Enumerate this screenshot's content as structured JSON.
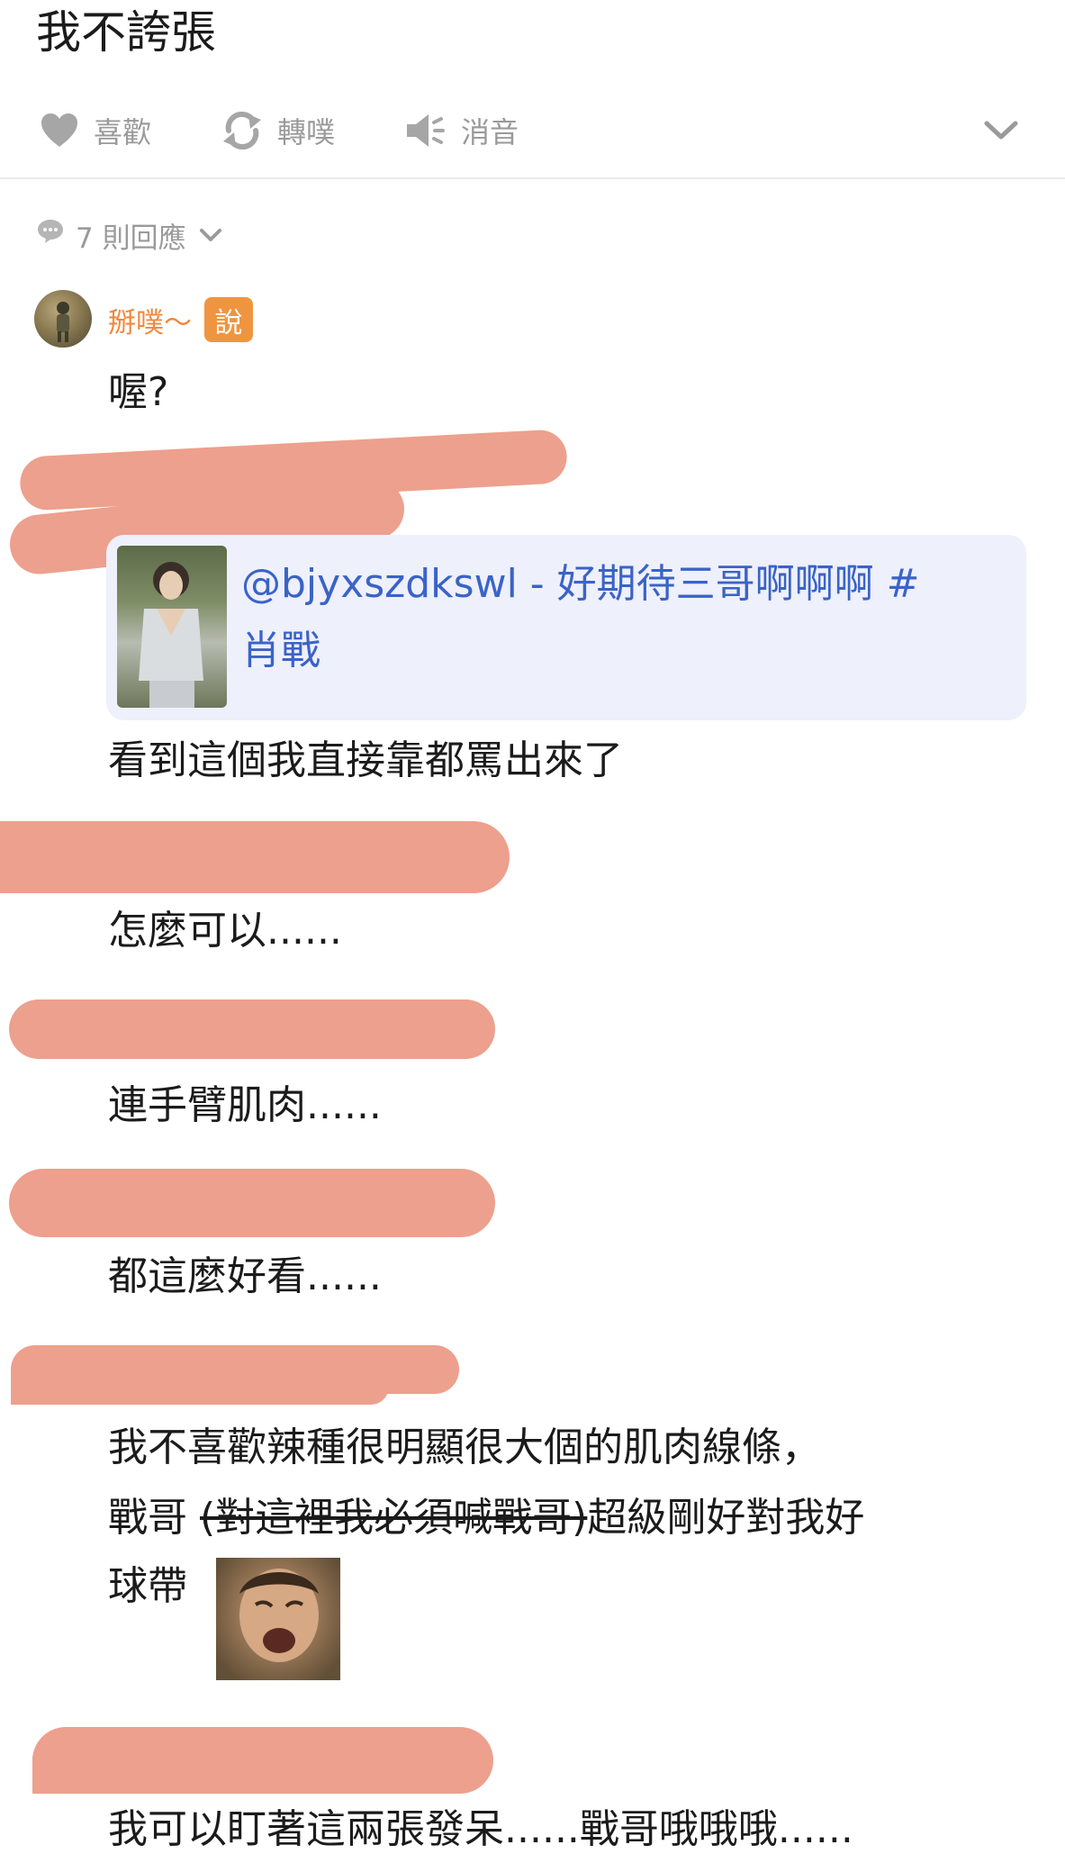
{
  "post": {
    "title": "我不誇張"
  },
  "actions": {
    "like": {
      "label": "喜歡",
      "icon": "heart-icon"
    },
    "replurk": {
      "label": "轉噗",
      "icon": "replurk-icon"
    },
    "mute": {
      "label": "消音",
      "icon": "mute-icon"
    },
    "expand": {
      "icon": "chevron-down-icon"
    }
  },
  "replies": {
    "count_label": "7 則回應",
    "author": {
      "name": "掰噗～",
      "badge": "說"
    },
    "messages": [
      "喔?",
      "看到這個我直接靠都罵出來了",
      "怎麼可以......",
      "連手臂肌肉......",
      "都這麼好看......",
      "我不喜歡辣種很明顯很大個的肌肉線條，",
      "戰哥",
      "(對這裡我必須喊戰哥)",
      "超級剛好對我好",
      "球帶",
      "我可以盯著這兩張發呆......戰哥哦哦哦......"
    ],
    "quote": {
      "text_line1": "@bjyxszdkswl - 好期待三哥啊啊啊 #",
      "text_line2": "肖戰"
    }
  },
  "colors": {
    "accent_orange": "#f0883d",
    "link_blue": "#3a63c8",
    "redaction": "#eda08d",
    "muted_gray": "#9a9a9a"
  }
}
